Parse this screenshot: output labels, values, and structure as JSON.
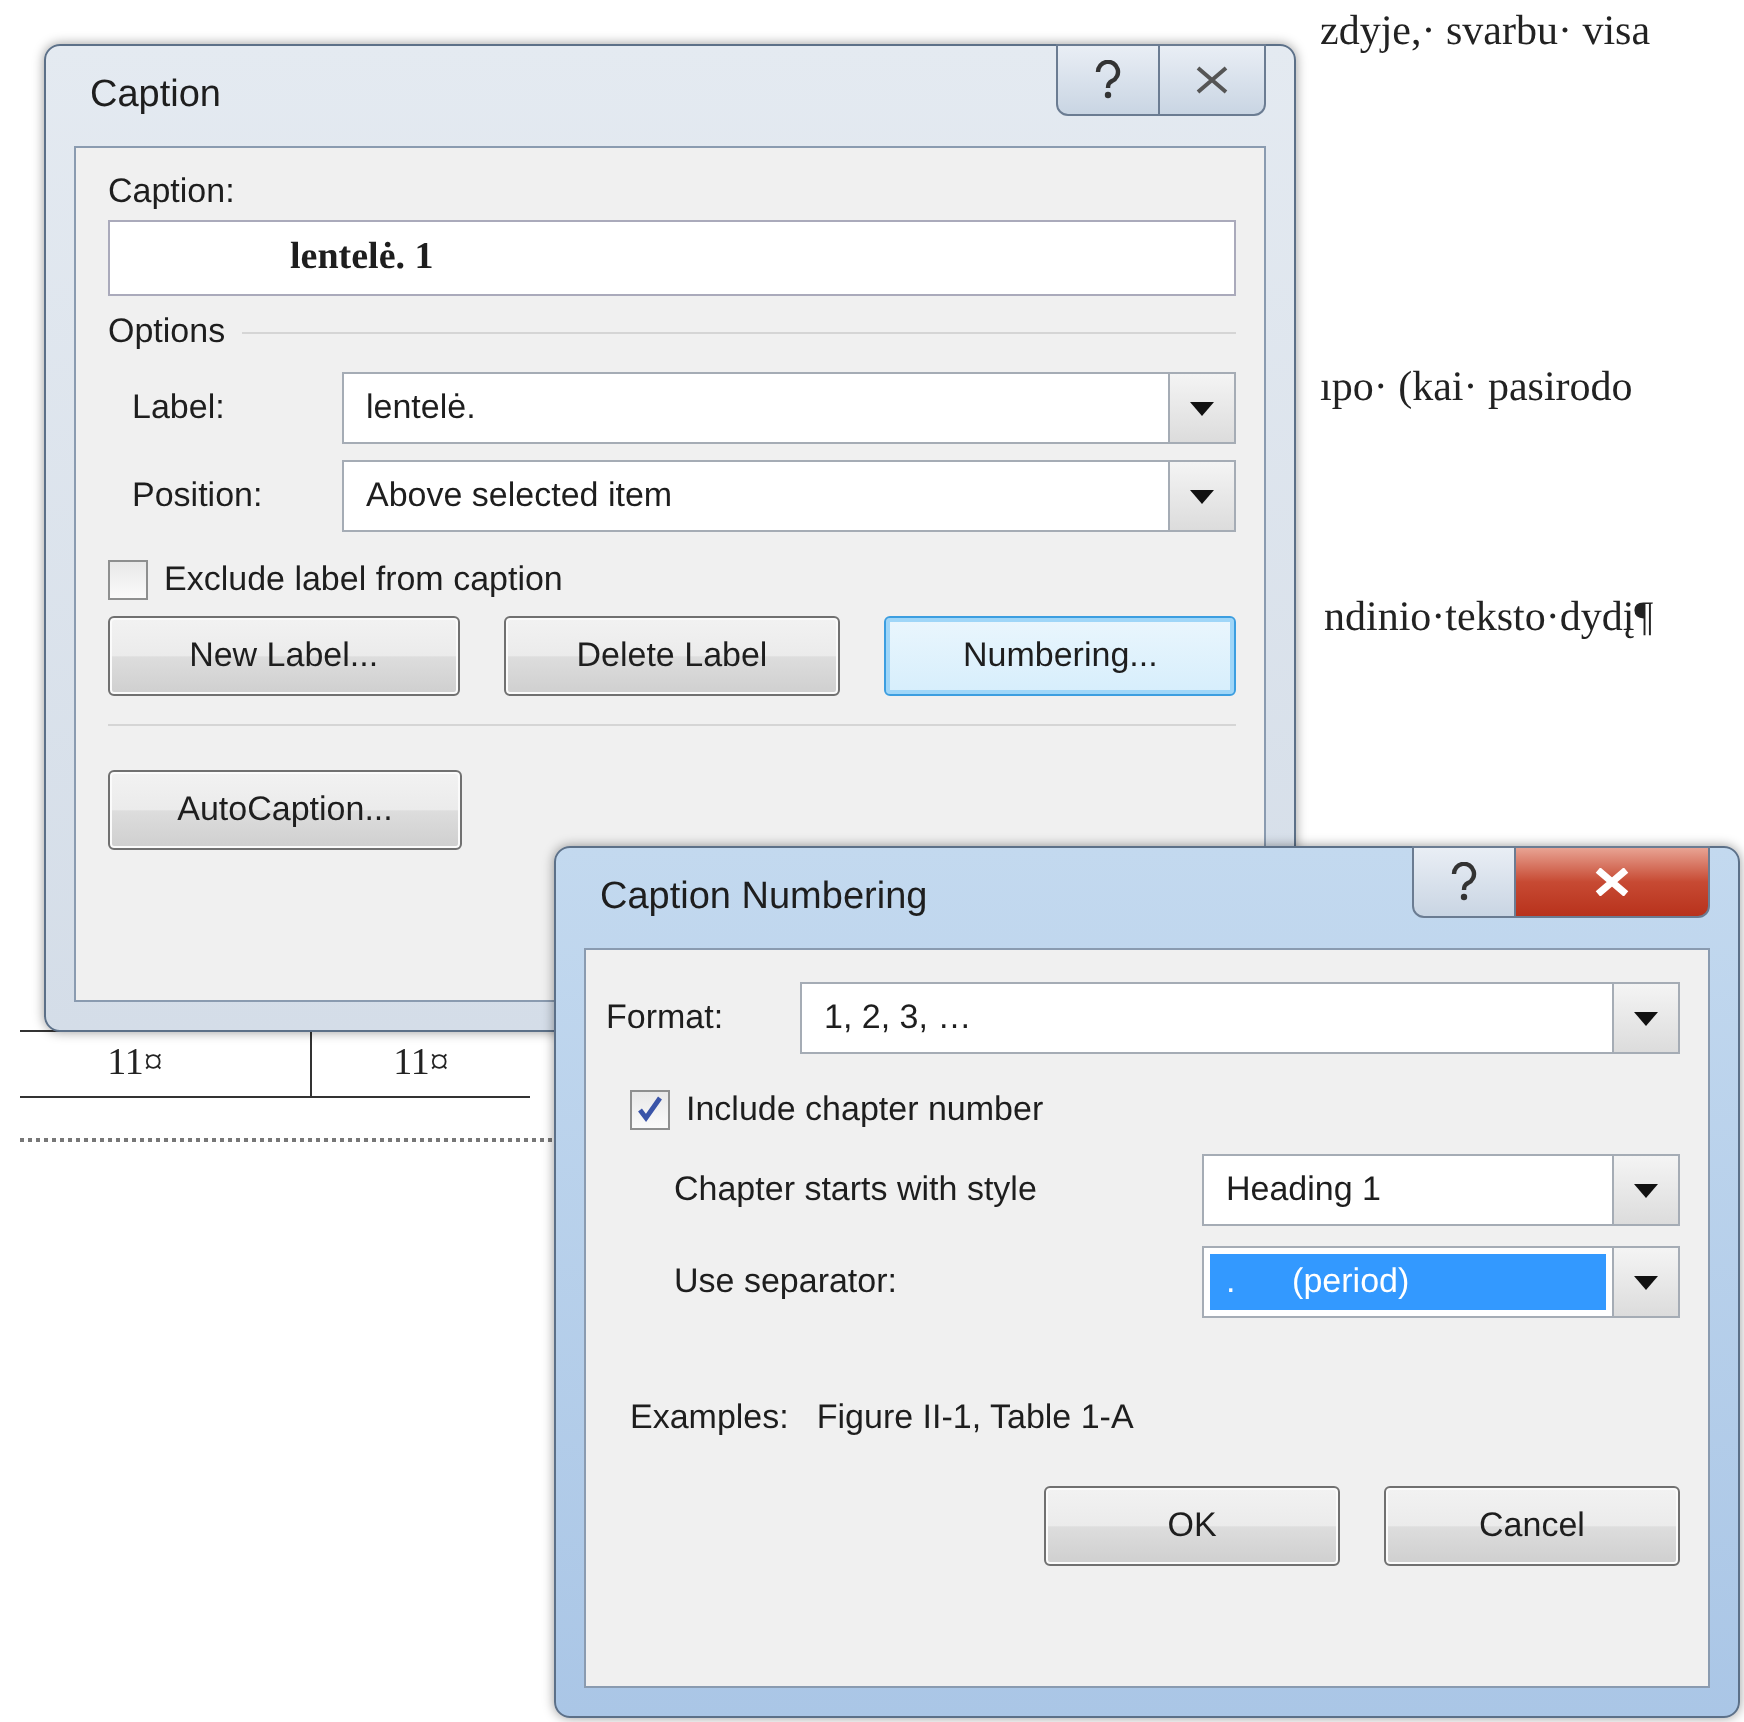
{
  "document": {
    "lines": [
      {
        "text": "zdyje,· svarbu· visa"
      },
      {
        "text": "ıpo· (kai· pasirodo"
      },
      {
        "text": "ndinio·teksto·dydį¶"
      }
    ],
    "table_cells": [
      "11¤",
      "11¤"
    ]
  },
  "caption_dialog": {
    "title": "Caption",
    "active": false,
    "caption_label": {
      "text": "Caption:"
    },
    "caption_value": "lentelė. 1",
    "options_heading": "Options",
    "fields": [
      {
        "label": "Label:",
        "value": "lentelė."
      },
      {
        "label": "Position:",
        "value": "Above selected item"
      }
    ],
    "exclude_checkbox": {
      "label": "Exclude label from caption",
      "checked": false
    },
    "buttons": [
      {
        "label": "New Label...",
        "focused": false
      },
      {
        "label": "Delete Label",
        "focused": false
      },
      {
        "label": "Numbering...",
        "focused": true
      }
    ],
    "autocaption_button": {
      "label": "AutoCaption..."
    }
  },
  "numbering_dialog": {
    "title": "Caption Numbering",
    "active": true,
    "format": {
      "label": "Format:",
      "value": "1, 2, 3, …"
    },
    "include_checkbox": {
      "label": "Include chapter number",
      "checked": true
    },
    "fields": [
      {
        "label": "Chapter starts with style",
        "value": "Heading 1",
        "highlighted": false
      },
      {
        "label": "Use separator:",
        "value": ".      (period)",
        "highlighted": true
      }
    ],
    "examples_label": "Examples:",
    "examples_value": "Figure II-1, Table 1-A",
    "buttons": [
      "OK",
      "Cancel"
    ]
  }
}
